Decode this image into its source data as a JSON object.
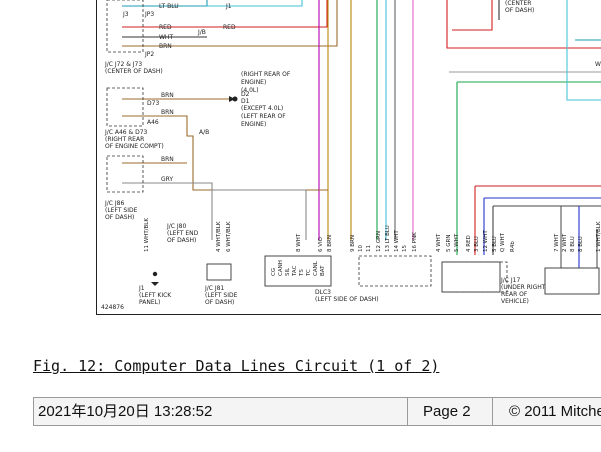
{
  "diagram": {
    "left_labels": [
      {
        "key": "jc72",
        "text": "J/C J72 & J73"
      },
      {
        "key": "center_dash",
        "text": "(CENTER OF DASH)"
      },
      {
        "key": "jc46",
        "text": "J/C A46 & D73"
      },
      {
        "key": "right_rear_l1",
        "text": "(RIGHT REAR"
      },
      {
        "key": "right_rear_l2",
        "text": "OF ENGINE COMPT)"
      },
      {
        "key": "jc86",
        "text": "J/C J86"
      },
      {
        "key": "left_side_l1",
        "text": "(LEFT SIDE"
      },
      {
        "key": "left_side_l2",
        "text": "OF DASH)"
      }
    ],
    "wire_labels": [
      {
        "key": "ltblu",
        "text": "LT BLU"
      },
      {
        "key": "red",
        "text": "RED"
      },
      {
        "key": "wht",
        "text": "WHT"
      },
      {
        "key": "brn1",
        "text": "BRN"
      },
      {
        "key": "brn2",
        "text": "BRN"
      },
      {
        "key": "brn3",
        "text": "BRN"
      },
      {
        "key": "brn4",
        "text": "BRN"
      },
      {
        "key": "gry",
        "text": "GRY"
      },
      {
        "key": "red2",
        "text": "RED"
      },
      {
        "key": "j1",
        "text": "J1"
      },
      {
        "key": "j3",
        "text": "J3"
      }
    ],
    "connector_labels": [
      {
        "key": "jp3",
        "text": "JP3"
      },
      {
        "key": "jp2",
        "text": "JP2"
      },
      {
        "key": "d73",
        "text": "D73"
      },
      {
        "key": "a46",
        "text": "A46"
      },
      {
        "key": "a/b",
        "text": "A/B"
      },
      {
        "key": "j/b",
        "text": "J/B"
      },
      {
        "key": "d2",
        "text": "D2"
      },
      {
        "key": "d1",
        "text": "D1"
      }
    ],
    "engine_labels": [
      "(RIGHT REAR OF",
      "ENGINE)",
      "(4.0L)",
      "(EXCEPT 4.0L)",
      "(LEFT REAR OF",
      "ENGINE)"
    ],
    "center_top": [
      "(CENTER",
      "OF DASH)"
    ],
    "bottom_labels": [
      {
        "key": "jc80",
        "lines": [
          "J/C J80",
          "(LEFT END",
          "OF DASH)"
        ]
      },
      {
        "key": "j1",
        "lines": [
          "J1",
          "(LEFT KICK",
          "PANEL)"
        ]
      },
      {
        "key": "jcj81",
        "lines": [
          "J/C J81",
          "(LEFT SIDE",
          "OF DASH)"
        ]
      },
      {
        "key": "dlc3",
        "lines": [
          "DLC3",
          "(LEFT SIDE OF DASH)"
        ]
      },
      {
        "key": "jcj17",
        "lines": [
          "J/C J17",
          "(UNDER RIGHT",
          "REAR OF",
          "VEHICLE)"
        ]
      }
    ],
    "dlc_pins": [
      "CG",
      "CANH",
      "SIL",
      "TAC",
      "TS",
      "TC",
      "CANL",
      "BAT"
    ],
    "vertical_wire_labels": [
      "11 WHT/BLK",
      "4 WHT/BLK",
      "6 WHT/BLK",
      "8 WHT",
      "6 VIO",
      "8 BRN",
      "9 BRN",
      "10",
      "11",
      "12 GRN",
      "13 LT BLU",
      "14 WHT",
      "15",
      "16 PNK",
      "4 WHT",
      "5 GRN",
      "5 WHT",
      "4 RED",
      "3 BLU",
      "12 WHT",
      "5 BLU",
      "Q WHT",
      "R4b",
      "7 WHT",
      "2 WHT",
      "8 BLU",
      "8 BLU",
      "1 WHT/BLK"
    ],
    "diagram_id": "424876",
    "right_edge_text": "W"
  },
  "caption": "Fig. 12: Computer Data Lines Circuit (1 of 2)",
  "footer": {
    "datetime": "2021年10月20日 13:28:52",
    "page": "Page 2",
    "copyright": "© 2011 Mitche"
  }
}
